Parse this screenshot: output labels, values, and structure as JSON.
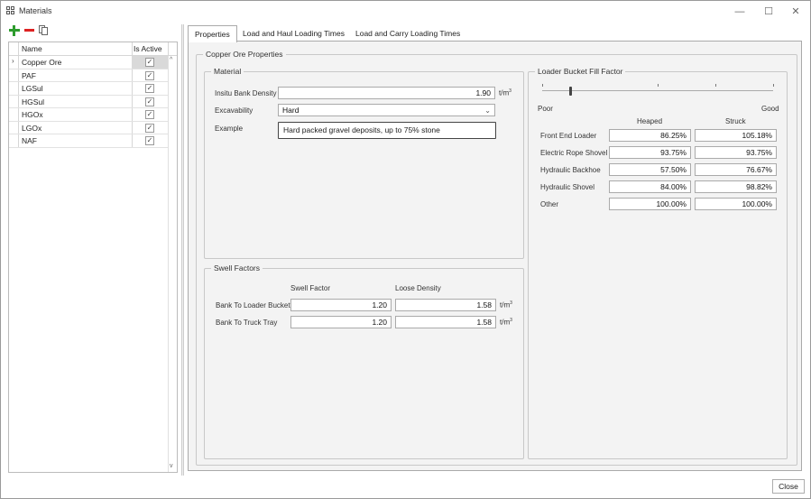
{
  "window": {
    "title": "Materials",
    "minimize": "—",
    "maximize": "☐",
    "close": "✕"
  },
  "toolbar": {
    "add_icon": "plus-icon",
    "remove_icon": "minus-icon",
    "copy_icon": "copy-icon"
  },
  "grid": {
    "headers": {
      "name": "Name",
      "is_active": "Is Active"
    },
    "rows": [
      {
        "name": "Copper Ore",
        "active": "✓",
        "selected": true
      },
      {
        "name": "PAF",
        "active": "✓"
      },
      {
        "name": "LGSul",
        "active": "✓"
      },
      {
        "name": "HGSul",
        "active": "✓"
      },
      {
        "name": "HGOx",
        "active": "✓"
      },
      {
        "name": "LGOx",
        "active": "✓"
      },
      {
        "name": "NAF",
        "active": "✓"
      }
    ],
    "row_indicator": "›",
    "scroll_up": "^",
    "scroll_down": "v"
  },
  "tabs": [
    {
      "label": "Properties",
      "active": true
    },
    {
      "label": "Load and Haul Loading Times"
    },
    {
      "label": "Load and Carry Loading Times"
    }
  ],
  "properties": {
    "group_title": "Copper Ore Properties",
    "material": {
      "title": "Material",
      "insitu_label": "Insitu Bank Density",
      "insitu_value": "1.90",
      "insitu_unit": "t/m",
      "unit_exp": "3",
      "excavability_label": "Excavability",
      "excavability_value": "Hard",
      "excavability_arrow": "⌄",
      "example_label": "Example",
      "example_value": "Hard packed gravel deposits, up to 75% stone"
    },
    "swell": {
      "title": "Swell Factors",
      "col_swell": "Swell Factor",
      "col_loose": "Loose Density",
      "unit": "t/m",
      "unit_exp": "3",
      "rows": [
        {
          "label": "Bank To Loader Bucket",
          "swell": "1.20",
          "loose": "1.58"
        },
        {
          "label": "Bank To Truck Tray",
          "swell": "1.20",
          "loose": "1.58"
        }
      ]
    },
    "fill": {
      "title": "Loader Bucket Fill Factor",
      "poor": "Poor",
      "good": "Good",
      "slider_level": 0.12,
      "col_heaped": "Heaped",
      "col_struck": "Struck",
      "rows": [
        {
          "label": "Front End Loader",
          "heaped": "86.25%",
          "struck": "105.18%"
        },
        {
          "label": "Electric Rope Shovel",
          "heaped": "93.75%",
          "struck": "93.75%"
        },
        {
          "label": "Hydraulic Backhoe",
          "heaped": "57.50%",
          "struck": "76.67%"
        },
        {
          "label": "Hydraulic Shovel",
          "heaped": "84.00%",
          "struck": "98.82%"
        },
        {
          "label": "Other",
          "heaped": "100.00%",
          "struck": "100.00%"
        }
      ]
    }
  },
  "footer": {
    "close_label": "Close"
  }
}
